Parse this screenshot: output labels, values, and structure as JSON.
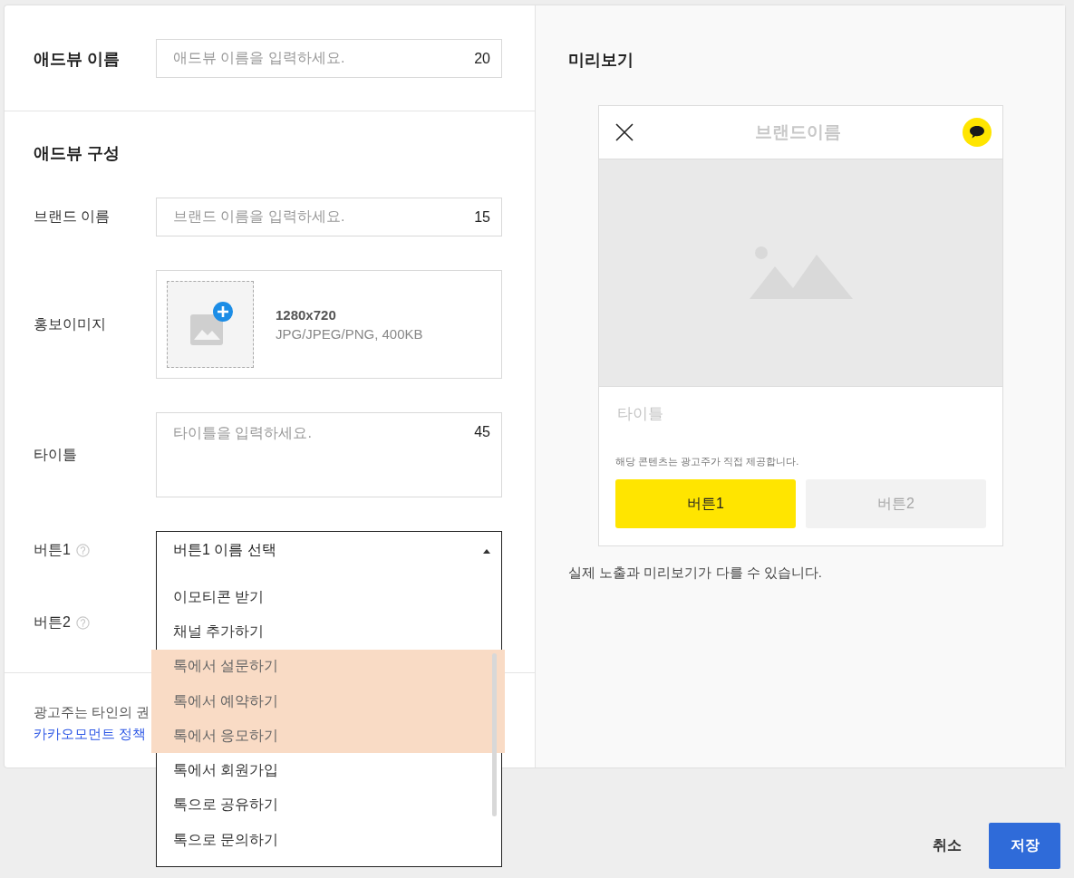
{
  "ad_name": {
    "label": "애드뷰 이름",
    "placeholder": "애드뷰 이름을 입력하세요.",
    "counter": "20"
  },
  "section_title": "애드뷰 구성",
  "brand_name": {
    "label": "브랜드 이름",
    "placeholder": "브랜드 이름을 입력하세요.",
    "counter": "15"
  },
  "promo_image": {
    "label": "홍보이미지",
    "size": "1280x720",
    "formats": "JPG/JPEG/PNG, 400KB"
  },
  "title_field": {
    "label": "타이틀",
    "placeholder": "타이틀을 입력하세요.",
    "counter": "45"
  },
  "button1": {
    "label": "버튼1",
    "value": "버튼1 이름 선택",
    "expanded": true,
    "options": [
      {
        "label": "이모티콘 받기",
        "highlighted": false
      },
      {
        "label": "채널 추가하기",
        "highlighted": false
      },
      {
        "label": "톡에서 설문하기",
        "highlighted": true
      },
      {
        "label": "톡에서 예약하기",
        "highlighted": true
      },
      {
        "label": "톡에서 응모하기",
        "highlighted": true
      },
      {
        "label": "톡에서 회원가입",
        "highlighted": false
      },
      {
        "label": "톡으로 공유하기",
        "highlighted": false
      },
      {
        "label": "톡으로 문의하기",
        "highlighted": false
      }
    ]
  },
  "button2": {
    "label": "버튼2"
  },
  "notice": {
    "text": "광고주는 타인의 권",
    "link": "카카오모먼트 정책"
  },
  "preview": {
    "heading": "미리보기",
    "brand": "브랜드이름",
    "title": "타이틀",
    "disclaimer": "해당 콘텐츠는 광고주가 직접 제공합니다.",
    "buttons": [
      {
        "label": "버튼1",
        "kind": "primary"
      },
      {
        "label": "버튼2",
        "kind": "disabled"
      }
    ],
    "caption": "실제 노출과 미리보기가 다를 수 있습니다."
  },
  "actions": [
    {
      "label": "취소",
      "kind": "text"
    },
    {
      "label": "저장",
      "kind": "primary"
    }
  ]
}
